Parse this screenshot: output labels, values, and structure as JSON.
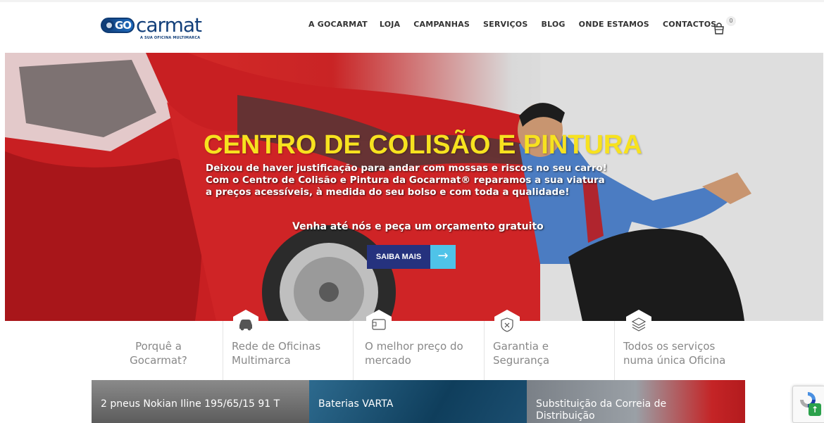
{
  "brand": {
    "logo_prefix": "GO",
    "logo_word": "carmat",
    "tagline": "A SUA OFICINA MULTIMARCA"
  },
  "nav": {
    "items": [
      "A GOCARMAT",
      "LOJA",
      "CAMPANHAS",
      "SERVIÇOS",
      "BLOG",
      "ONDE ESTAMOS",
      "CONTACTOS"
    ],
    "cart_count": "0"
  },
  "hero": {
    "title": "CENTRO DE COLISÃO E PINTURA",
    "lines": [
      "Deixou de haver justificação para andar com mossas e riscos no seu carro!",
      "Com o Centro de Colisão e Pintura da Gocarmat® reparamos a sua viatura",
      "a preços acessíveis, à medida do seu bolso e com toda a qualidade!"
    ],
    "cta_text": "Venha até nós e peça um orçamento gratuito",
    "button_label": "SAIBA MAIS",
    "button_arrow": "→"
  },
  "features": [
    {
      "line1": "Porquê a",
      "line2": "Gocarmat?",
      "icon": "none"
    },
    {
      "line1": "Rede de Oficinas",
      "line2": "Multimarca",
      "icon": "car-icon"
    },
    {
      "line1": "O melhor preço do",
      "line2": "mercado",
      "icon": "wallet-icon"
    },
    {
      "line1": "Garantia e",
      "line2": "Segurança",
      "icon": "shield-icon"
    },
    {
      "line1": "Todos os serviços",
      "line2": "numa única Oficina",
      "icon": "layers-icon"
    }
  ],
  "products": [
    {
      "title": "2 pneus Nokian Iline 195/65/15 91 T",
      "title2": ""
    },
    {
      "title": "Baterias VARTA",
      "title2": ""
    },
    {
      "title": "Substituição da Correia de",
      "title2": "Distribuição"
    }
  ],
  "colors": {
    "accent_yellow": "#f7e21f",
    "button_blue": "#25327e",
    "button_arrow_bg": "#4fc3e8",
    "brand_blue": "#123f7a"
  }
}
